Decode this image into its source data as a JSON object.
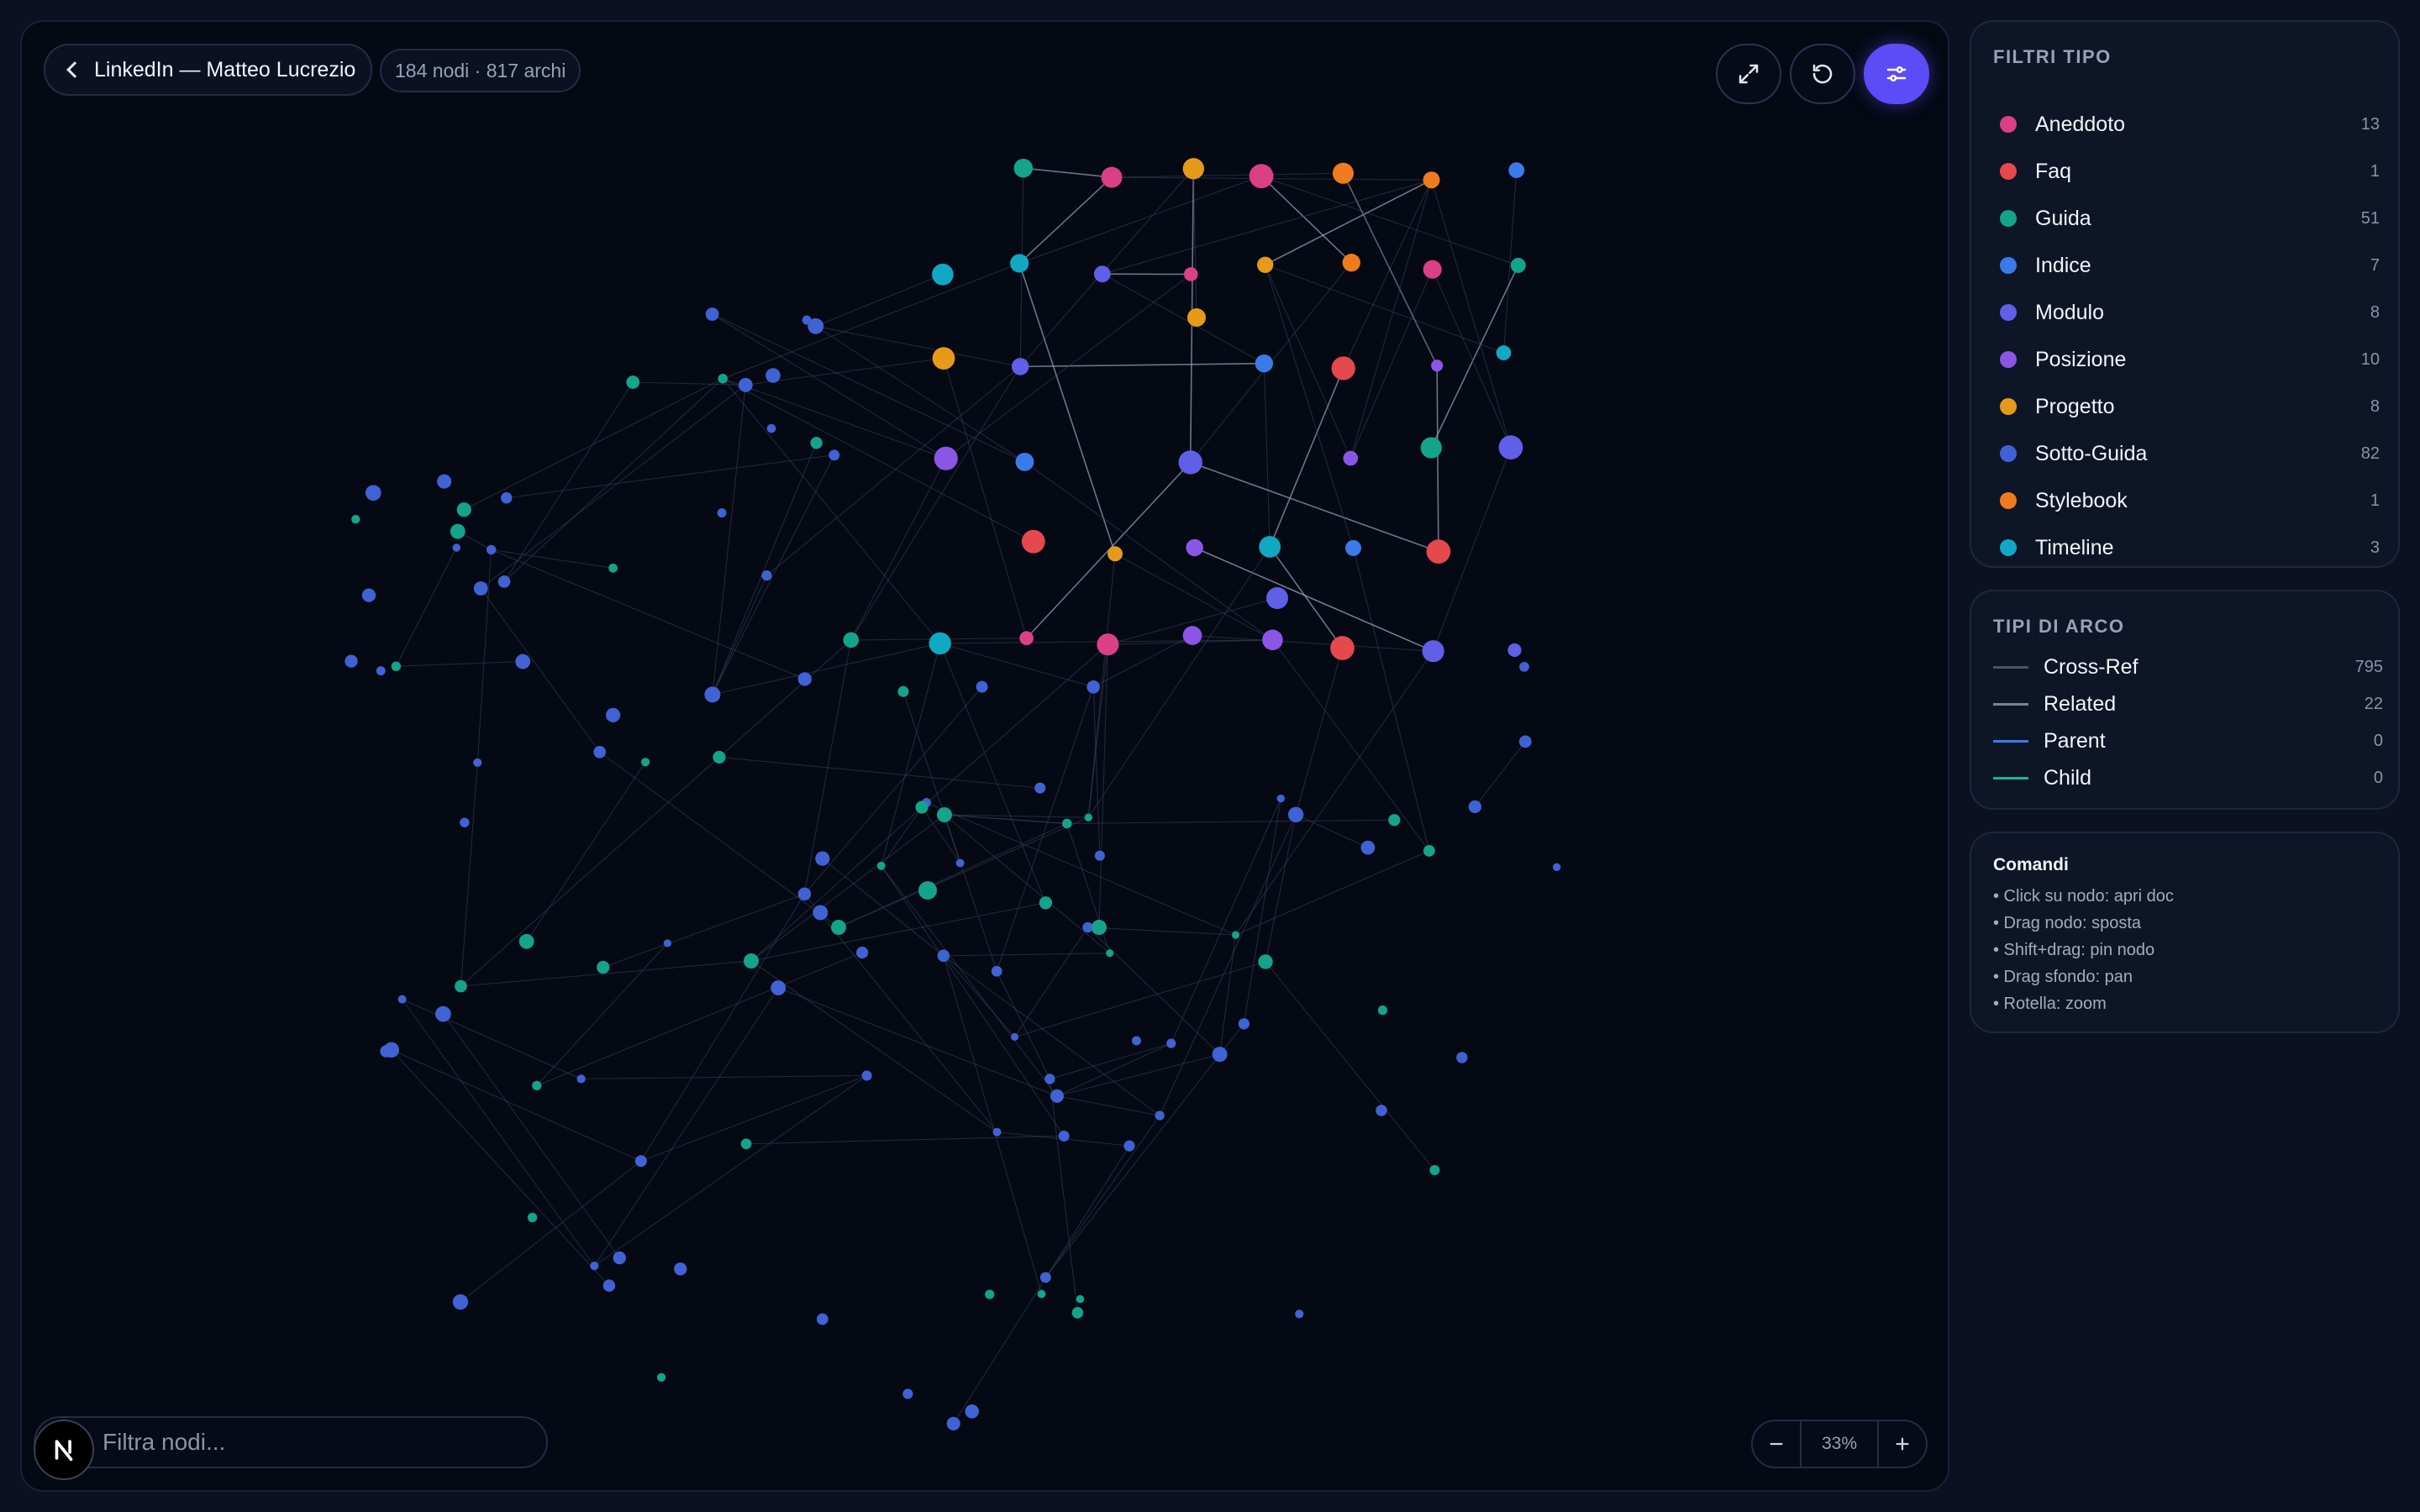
{
  "header": {
    "back_label": "LinkedIn — Matteo Lucrezio",
    "graph_count": "184 nodi · 817 archi"
  },
  "search": {
    "placeholder": "Filtra nodi..."
  },
  "zoom": {
    "value": "33%"
  },
  "icons": {
    "fullscreen": "expand-arrows-icon",
    "reset": "rotate-ccw-icon",
    "settings": "sliders-icon",
    "logo": "next-logo-icon",
    "back": "chevron-left-icon"
  },
  "filters": {
    "title": "FILTRI TIPO",
    "items": [
      {
        "name": "Aneddoto",
        "count": "13",
        "color": "#db3f86"
      },
      {
        "name": "Faq",
        "count": "1",
        "color": "#e5484d"
      },
      {
        "name": "Guida",
        "count": "51",
        "color": "#14a38b"
      },
      {
        "name": "Indice",
        "count": "7",
        "color": "#3b7be8"
      },
      {
        "name": "Modulo",
        "count": "8",
        "color": "#5f5fe8"
      },
      {
        "name": "Posizione",
        "count": "10",
        "color": "#8b55e6"
      },
      {
        "name": "Progetto",
        "count": "8",
        "color": "#e79a1a"
      },
      {
        "name": "Sotto-Guida",
        "count": "82",
        "color": "#4062d4"
      },
      {
        "name": "Stylebook",
        "count": "1",
        "color": "#f07a1e"
      },
      {
        "name": "Timeline",
        "count": "3",
        "color": "#11a8c4"
      }
    ]
  },
  "edge_types": {
    "title": "TIPI DI ARCO",
    "items": [
      {
        "name": "Cross-Ref",
        "count": "795",
        "color": "#4b5263"
      },
      {
        "name": "Related",
        "count": "22",
        "color": "#7b8294"
      },
      {
        "name": "Parent",
        "count": "0",
        "color": "#3b7be8"
      },
      {
        "name": "Child",
        "count": "0",
        "color": "#14b89b"
      }
    ]
  },
  "commands": {
    "title": "Comandi",
    "items": [
      "• Click su nodo: apri doc",
      "• Drag nodo: sposta",
      "• Shift+drag: pin nodo",
      "• Drag sfondo: pan",
      "• Rotella: zoom"
    ]
  }
}
